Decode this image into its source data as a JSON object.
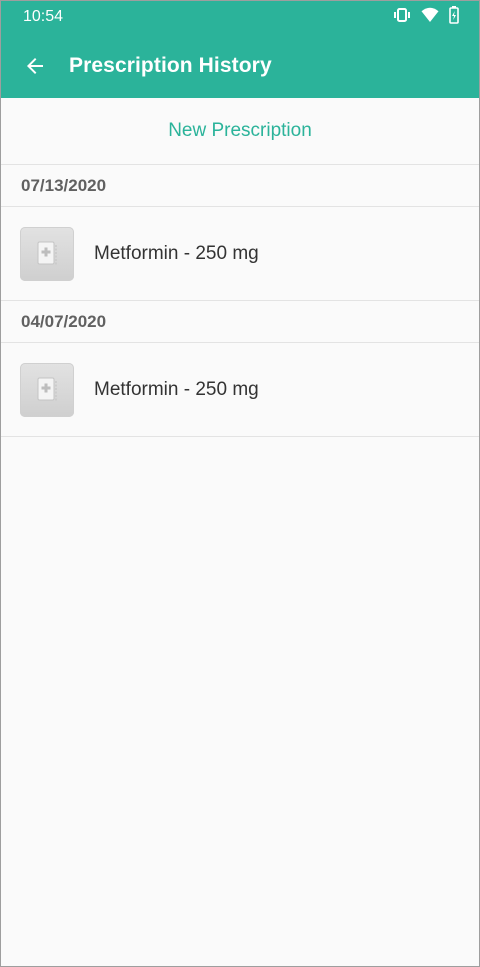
{
  "status": {
    "time": "10:54"
  },
  "toolbar": {
    "title": "Prescription History"
  },
  "actions": {
    "new_prescription": "New Prescription"
  },
  "sections": [
    {
      "date": "07/13/2020",
      "items": [
        {
          "label": "Metformin - 250 mg"
        }
      ]
    },
    {
      "date": "04/07/2020",
      "items": [
        {
          "label": "Metformin - 250 mg"
        }
      ]
    }
  ],
  "colors": {
    "accent": "#2bb39a",
    "header_text": "#616161",
    "divider": "#e3e3e3"
  },
  "icons": {
    "back": "arrow-left-icon",
    "vibrate": "vibrate-icon",
    "wifi": "wifi-icon",
    "battery": "battery-charging-icon",
    "prescription": "prescription-doc-icon"
  }
}
